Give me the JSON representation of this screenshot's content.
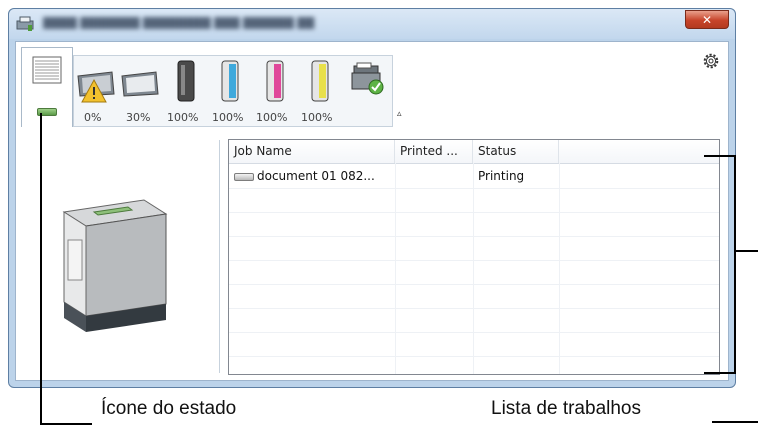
{
  "toolbar": {
    "levels": [
      "0%",
      "30%",
      "100%",
      "100%",
      "100%",
      "100%"
    ],
    "icons": [
      "document-stack-icon",
      "paper-tray-warning-icon",
      "paper-tray-icon",
      "toner-black-icon",
      "toner-cyan-icon",
      "toner-magenta-icon",
      "toner-yellow-icon",
      "mfp-ok-icon",
      "collapse-icon",
      "gear-icon"
    ],
    "toggle_glyph": "▵"
  },
  "window": {
    "close_glyph": "✕"
  },
  "job_list": {
    "columns": [
      "Job Name",
      "Printed ...",
      "Status"
    ],
    "rows": [
      {
        "name": "document 01 082...",
        "printed": "",
        "status": "Printing"
      }
    ]
  },
  "annotations": {
    "status_icon_label": "Ícone do estado",
    "job_list_label": "Lista de trabalhos"
  },
  "colors": {
    "status_led": "#6ab04c",
    "toner_black": "#555555",
    "toner_cyan": "#3fa9dc",
    "toner_magenta": "#e0479a",
    "toner_yellow": "#e8e04a"
  }
}
